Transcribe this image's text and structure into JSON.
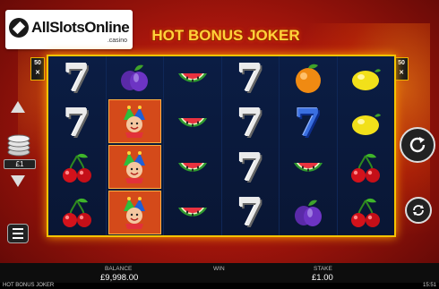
{
  "watermark": {
    "brand": "AllSlotsOnline",
    "sub": ".casino"
  },
  "game": {
    "title": "HOT BONUS JOKER"
  },
  "paylines": {
    "left": "50",
    "right": "50"
  },
  "reels": [
    [
      "seven",
      "seven",
      "cherry",
      "cherry"
    ],
    [
      "plum",
      "joker",
      "joker",
      "joker"
    ],
    [
      "watermelon",
      "watermelon",
      "watermelon",
      "watermelon"
    ],
    [
      "seven",
      "seven",
      "seven",
      "seven"
    ],
    [
      "orange",
      "seven-blue",
      "watermelon",
      "plum"
    ],
    [
      "lemon",
      "lemon",
      "cherry",
      "cherry"
    ]
  ],
  "stake_selector": {
    "value": "£1"
  },
  "bottom_bar": {
    "balance_label": "BALANCE",
    "balance_value": "£9,998.00",
    "win_label": "WIN",
    "win_value": "",
    "stake_label": "STAKE",
    "stake_value": "£1.00"
  },
  "footer": {
    "game_name": "HOT BONUS JOKER",
    "time": "15:51"
  },
  "colors": {
    "frame": "#f5c400",
    "reel_bg": "#0b1d44",
    "background": "#a8160c"
  }
}
